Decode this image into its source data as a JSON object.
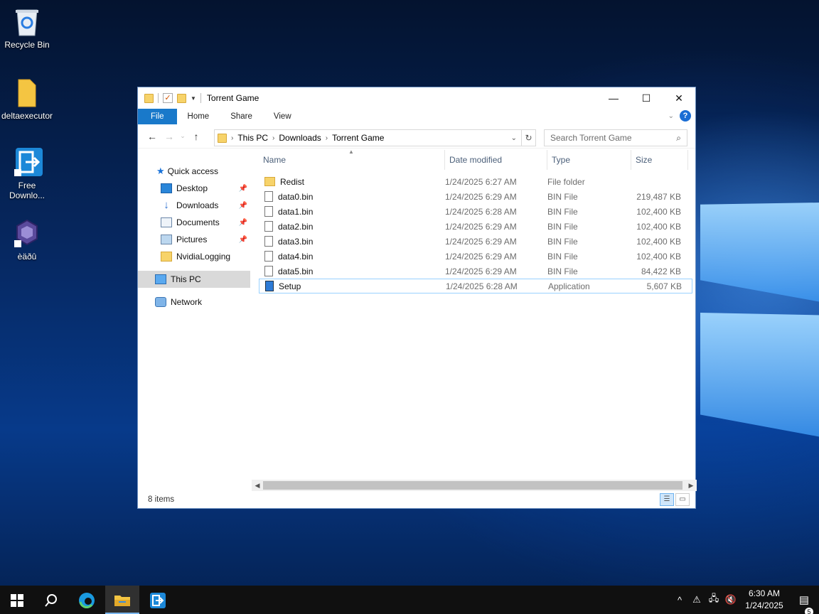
{
  "desktop": {
    "icons": [
      {
        "label": "Recycle Bin",
        "icon": "recycle-bin-icon"
      },
      {
        "label": "deltaexecutor",
        "icon": "folder-icon"
      },
      {
        "label_line1": "Free",
        "label_line2": "Downlo...",
        "icon": "free-download-manager-icon"
      },
      {
        "label": "èäðû",
        "icon": "gamecube-icon"
      }
    ]
  },
  "window": {
    "title": "Torrent Game",
    "controls": {
      "minimize": "—",
      "maximize": "☐",
      "close": "✕"
    },
    "ribbon_tabs": [
      "File",
      "Home",
      "Share",
      "View"
    ],
    "address": {
      "crumbs": [
        "This PC",
        "Downloads",
        "Torrent Game"
      ],
      "search_placeholder": "Search Torrent Game"
    },
    "nav_pane": {
      "quick_access": "Quick access",
      "pinned": [
        "Desktop",
        "Downloads",
        "Documents",
        "Pictures"
      ],
      "other": "NvidiaLogging",
      "this_pc": "This PC",
      "network": "Network"
    },
    "columns": [
      "Name",
      "Date modified",
      "Type",
      "Size"
    ],
    "files": [
      {
        "name": "Redist",
        "date": "1/24/2025 6:27 AM",
        "type": "File folder",
        "size": "",
        "icon": "folder-icon"
      },
      {
        "name": "data0.bin",
        "date": "1/24/2025 6:29 AM",
        "type": "BIN File",
        "size": "219,487 KB",
        "icon": "file-icon"
      },
      {
        "name": "data1.bin",
        "date": "1/24/2025 6:28 AM",
        "type": "BIN File",
        "size": "102,400 KB",
        "icon": "file-icon"
      },
      {
        "name": "data2.bin",
        "date": "1/24/2025 6:29 AM",
        "type": "BIN File",
        "size": "102,400 KB",
        "icon": "file-icon"
      },
      {
        "name": "data3.bin",
        "date": "1/24/2025 6:29 AM",
        "type": "BIN File",
        "size": "102,400 KB",
        "icon": "file-icon"
      },
      {
        "name": "data4.bin",
        "date": "1/24/2025 6:29 AM",
        "type": "BIN File",
        "size": "102,400 KB",
        "icon": "file-icon"
      },
      {
        "name": "data5.bin",
        "date": "1/24/2025 6:29 AM",
        "type": "BIN File",
        "size": "84,422 KB",
        "icon": "file-icon"
      },
      {
        "name": "Setup",
        "date": "1/24/2025 6:28 AM",
        "type": "Application",
        "size": "5,607 KB",
        "icon": "setup-app-icon"
      }
    ],
    "status": "8 items"
  },
  "taskbar": {
    "time": "6:30 AM",
    "date": "1/24/2025",
    "notification_count": "5"
  }
}
